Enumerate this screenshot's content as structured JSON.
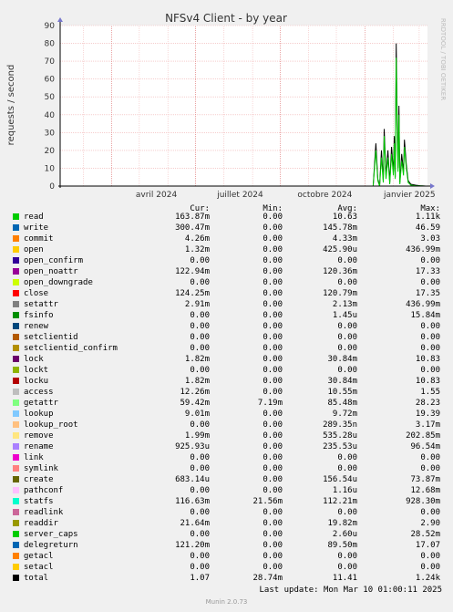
{
  "title": "NFSv4 Client - by year",
  "ylabel": "requests / second",
  "watermark": "RRDTOOL / TOBI OETIKER",
  "columns": {
    "cur": "Cur:",
    "min": "Min:",
    "avg": "Avg:",
    "max": "Max:"
  },
  "last_update": "Last update: Mon Mar 10 01:00:11 2025",
  "munin_version": "Munin 2.0.73",
  "chart_data": {
    "type": "line",
    "title": "NFSv4 Client - by year",
    "ylabel": "requests / second",
    "ylim": [
      0,
      90
    ],
    "yticks": [
      0,
      10,
      20,
      30,
      40,
      50,
      60,
      70,
      80,
      90
    ],
    "xlim": [
      "2024-02-05",
      "2025-03-10"
    ],
    "xticks": [
      {
        "date": "2024-04-01",
        "label": "avril 2024"
      },
      {
        "date": "2024-07-01",
        "label": "juillet 2024"
      },
      {
        "date": "2024-10-01",
        "label": "octobre 2024"
      },
      {
        "date": "2025-01-01",
        "label": "janvier 2025"
      }
    ],
    "grid": true,
    "series": [
      {
        "name": "total",
        "color": "#000000",
        "points": [
          [
            "2025-01-10",
            0
          ],
          [
            "2025-01-13",
            24
          ],
          [
            "2025-01-15",
            4
          ],
          [
            "2025-01-17",
            0
          ],
          [
            "2025-01-19",
            20
          ],
          [
            "2025-01-21",
            3
          ],
          [
            "2025-01-22",
            32
          ],
          [
            "2025-01-24",
            6
          ],
          [
            "2025-01-26",
            20
          ],
          [
            "2025-01-28",
            2
          ],
          [
            "2025-01-30",
            22
          ],
          [
            "2025-02-01",
            8
          ],
          [
            "2025-02-02",
            28
          ],
          [
            "2025-02-03",
            5
          ],
          [
            "2025-02-04",
            80
          ],
          [
            "2025-02-05",
            40
          ],
          [
            "2025-02-06",
            10
          ],
          [
            "2025-02-07",
            45
          ],
          [
            "2025-02-08",
            2
          ],
          [
            "2025-02-10",
            18
          ],
          [
            "2025-02-12",
            8
          ],
          [
            "2025-02-13",
            26
          ],
          [
            "2025-02-15",
            12
          ],
          [
            "2025-02-17",
            3
          ],
          [
            "2025-02-20",
            1
          ],
          [
            "2025-02-25",
            0.5
          ],
          [
            "2025-03-02",
            0.2
          ],
          [
            "2025-03-08",
            0
          ]
        ]
      },
      {
        "name": "read",
        "color": "#00CC00",
        "points": [
          [
            "2025-01-10",
            0
          ],
          [
            "2025-01-13",
            20
          ],
          [
            "2025-01-15",
            3
          ],
          [
            "2025-01-17",
            0
          ],
          [
            "2025-01-19",
            16
          ],
          [
            "2025-01-21",
            2
          ],
          [
            "2025-01-22",
            28
          ],
          [
            "2025-01-24",
            4
          ],
          [
            "2025-01-26",
            16
          ],
          [
            "2025-01-28",
            1
          ],
          [
            "2025-01-30",
            18
          ],
          [
            "2025-02-01",
            6
          ],
          [
            "2025-02-02",
            24
          ],
          [
            "2025-02-03",
            4
          ],
          [
            "2025-02-04",
            72
          ],
          [
            "2025-02-05",
            34
          ],
          [
            "2025-02-06",
            8
          ],
          [
            "2025-02-07",
            40
          ],
          [
            "2025-02-08",
            1
          ],
          [
            "2025-02-10",
            14
          ],
          [
            "2025-02-12",
            6
          ],
          [
            "2025-02-13",
            22
          ],
          [
            "2025-02-15",
            10
          ],
          [
            "2025-02-17",
            2
          ],
          [
            "2025-02-20",
            0.5
          ],
          [
            "2025-02-25",
            0.2
          ],
          [
            "2025-03-02",
            0.1
          ],
          [
            "2025-03-08",
            0
          ]
        ]
      }
    ]
  },
  "legend": [
    {
      "name": "read",
      "color": "#00CC00",
      "cur": "163.87m",
      "min": "0.00",
      "avg": "10.63",
      "max": "1.11k"
    },
    {
      "name": "write",
      "color": "#0066B3",
      "cur": "300.47m",
      "min": "0.00",
      "avg": "145.78m",
      "max": "46.59"
    },
    {
      "name": "commit",
      "color": "#FF8000",
      "cur": "4.26m",
      "min": "0.00",
      "avg": "4.33m",
      "max": "3.03"
    },
    {
      "name": "open",
      "color": "#FFCC00",
      "cur": "1.32m",
      "min": "0.00",
      "avg": "425.90u",
      "max": "436.99m"
    },
    {
      "name": "open_confirm",
      "color": "#330099",
      "cur": "0.00",
      "min": "0.00",
      "avg": "0.00",
      "max": "0.00"
    },
    {
      "name": "open_noattr",
      "color": "#990099",
      "cur": "122.94m",
      "min": "0.00",
      "avg": "120.36m",
      "max": "17.33"
    },
    {
      "name": "open_downgrade",
      "color": "#CCFF00",
      "cur": "0.00",
      "min": "0.00",
      "avg": "0.00",
      "max": "0.00"
    },
    {
      "name": "close",
      "color": "#FF0000",
      "cur": "124.25m",
      "min": "0.00",
      "avg": "120.79m",
      "max": "17.35"
    },
    {
      "name": "setattr",
      "color": "#808080",
      "cur": "2.91m",
      "min": "0.00",
      "avg": "2.13m",
      "max": "436.99m"
    },
    {
      "name": "fsinfo",
      "color": "#008F00",
      "cur": "0.00",
      "min": "0.00",
      "avg": "1.45u",
      "max": "15.84m"
    },
    {
      "name": "renew",
      "color": "#00487D",
      "cur": "0.00",
      "min": "0.00",
      "avg": "0.00",
      "max": "0.00"
    },
    {
      "name": "setclientid",
      "color": "#B35A00",
      "cur": "0.00",
      "min": "0.00",
      "avg": "0.00",
      "max": "0.00"
    },
    {
      "name": "setclientid_confirm",
      "color": "#B38F00",
      "cur": "0.00",
      "min": "0.00",
      "avg": "0.00",
      "max": "0.00"
    },
    {
      "name": "lock",
      "color": "#6B006B",
      "cur": "1.82m",
      "min": "0.00",
      "avg": "30.84m",
      "max": "10.83"
    },
    {
      "name": "lockt",
      "color": "#8FB300",
      "cur": "0.00",
      "min": "0.00",
      "avg": "0.00",
      "max": "0.00"
    },
    {
      "name": "locku",
      "color": "#B30000",
      "cur": "1.82m",
      "min": "0.00",
      "avg": "30.84m",
      "max": "10.83"
    },
    {
      "name": "access",
      "color": "#BEBEBE",
      "cur": "12.26m",
      "min": "0.00",
      "avg": "10.55m",
      "max": "1.55"
    },
    {
      "name": "getattr",
      "color": "#80FF80",
      "cur": "59.42m",
      "min": "7.19m",
      "avg": "85.48m",
      "max": "28.23"
    },
    {
      "name": "lookup",
      "color": "#80C9FF",
      "cur": "9.01m",
      "min": "0.00",
      "avg": "9.72m",
      "max": "19.39"
    },
    {
      "name": "lookup_root",
      "color": "#FFC080",
      "cur": "0.00",
      "min": "0.00",
      "avg": "289.35n",
      "max": "3.17m"
    },
    {
      "name": "remove",
      "color": "#FFE680",
      "cur": "1.99m",
      "min": "0.00",
      "avg": "535.28u",
      "max": "202.85m"
    },
    {
      "name": "rename",
      "color": "#AA80FF",
      "cur": "925.93u",
      "min": "0.00",
      "avg": "235.53u",
      "max": "96.54m"
    },
    {
      "name": "link",
      "color": "#EE00CC",
      "cur": "0.00",
      "min": "0.00",
      "avg": "0.00",
      "max": "0.00"
    },
    {
      "name": "symlink",
      "color": "#FF8080",
      "cur": "0.00",
      "min": "0.00",
      "avg": "0.00",
      "max": "0.00"
    },
    {
      "name": "create",
      "color": "#666600",
      "cur": "683.14u",
      "min": "0.00",
      "avg": "156.54u",
      "max": "73.87m"
    },
    {
      "name": "pathconf",
      "color": "#FFBFFF",
      "cur": "0.00",
      "min": "0.00",
      "avg": "1.16u",
      "max": "12.68m"
    },
    {
      "name": "statfs",
      "color": "#00FFCC",
      "cur": "116.63m",
      "min": "21.56m",
      "avg": "112.21m",
      "max": "928.30m"
    },
    {
      "name": "readlink",
      "color": "#CC6699",
      "cur": "0.00",
      "min": "0.00",
      "avg": "0.00",
      "max": "0.00"
    },
    {
      "name": "readdir",
      "color": "#999900",
      "cur": "21.64m",
      "min": "0.00",
      "avg": "19.82m",
      "max": "2.90"
    },
    {
      "name": "server_caps",
      "color": "#00CC00",
      "cur": "0.00",
      "min": "0.00",
      "avg": "2.60u",
      "max": "28.52m"
    },
    {
      "name": "delegreturn",
      "color": "#0066B3",
      "cur": "121.20m",
      "min": "0.00",
      "avg": "89.50m",
      "max": "17.07"
    },
    {
      "name": "getacl",
      "color": "#FF8000",
      "cur": "0.00",
      "min": "0.00",
      "avg": "0.00",
      "max": "0.00"
    },
    {
      "name": "setacl",
      "color": "#FFCC00",
      "cur": "0.00",
      "min": "0.00",
      "avg": "0.00",
      "max": "0.00"
    },
    {
      "name": "total",
      "color": "#000000",
      "cur": "1.07",
      "min": "28.74m",
      "avg": "11.41",
      "max": "1.24k"
    }
  ]
}
